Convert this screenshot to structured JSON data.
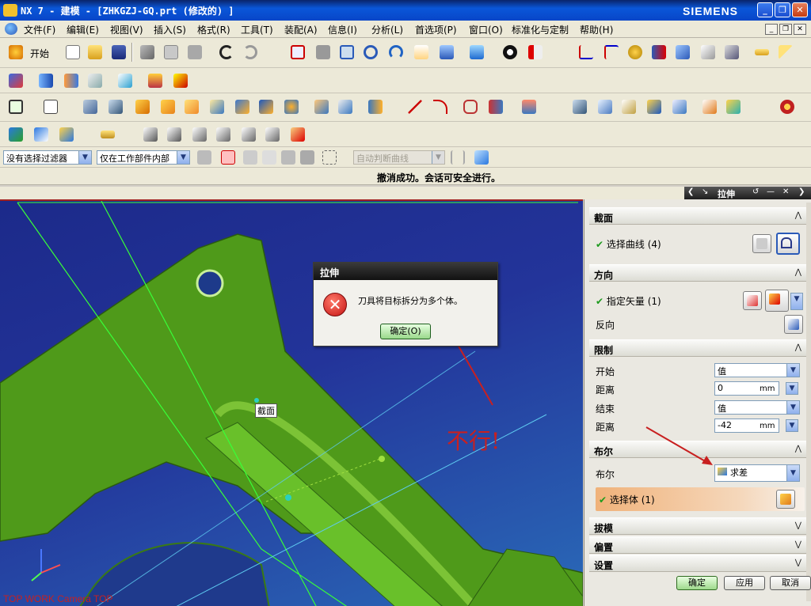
{
  "window": {
    "title": "NX 7 - 建模 - [ZHKGZJ-GQ.prt (修改的) ]",
    "brand": "SIEMENS",
    "min": "_",
    "restore": "❐",
    "close": "✕"
  },
  "menu": {
    "items": [
      "文件(F)",
      "编辑(E)",
      "视图(V)",
      "插入(S)",
      "格式(R)",
      "工具(T)",
      "装配(A)",
      "信息(I)",
      "分析(L)",
      "首选项(P)",
      "窗口(O)",
      "标准化与定制",
      "帮助(H)"
    ],
    "start_label": "开始"
  },
  "filters": {
    "type_filter": "没有选择过滤器",
    "scope_filter": "仅在工作部件内部",
    "curve_rule": "自动判断曲线"
  },
  "status": {
    "message": "撤消成功。会话可安全进行。"
  },
  "viewport": {
    "section_label": "截面",
    "annotation": "不行!",
    "view_info": "TOP WORK Camera TOP"
  },
  "error_dialog": {
    "title": "拉伸",
    "message": "刀具将目标拆分为多个体。",
    "ok_label": "确定(O)"
  },
  "panel": {
    "title": "拉伸",
    "sections": {
      "section": "截面",
      "direction": "方向",
      "limits": "限制",
      "boolean": "布尔",
      "draft": "拔模",
      "offset": "偏置",
      "settings": "设置"
    },
    "select_curve": "选择曲线 (4)",
    "specify_vector": "指定矢量 (1)",
    "reverse": "反向",
    "start_label": "开始",
    "start_value": "值",
    "dist1_label": "距离",
    "dist1_value": "0",
    "end_label": "结束",
    "end_value": "值",
    "dist2_label": "距离",
    "dist2_value": "-42",
    "unit": "mm",
    "boolean_label": "布尔",
    "boolean_value": "求差",
    "select_body": "选择体 (1)",
    "ok": "确定",
    "apply": "应用",
    "cancel": "取消"
  },
  "colors": {
    "title_blue": "#0846c8",
    "model_green": "#4f9a1a",
    "annotation_red": "#c82020",
    "check_green": "#1d9a1d"
  }
}
